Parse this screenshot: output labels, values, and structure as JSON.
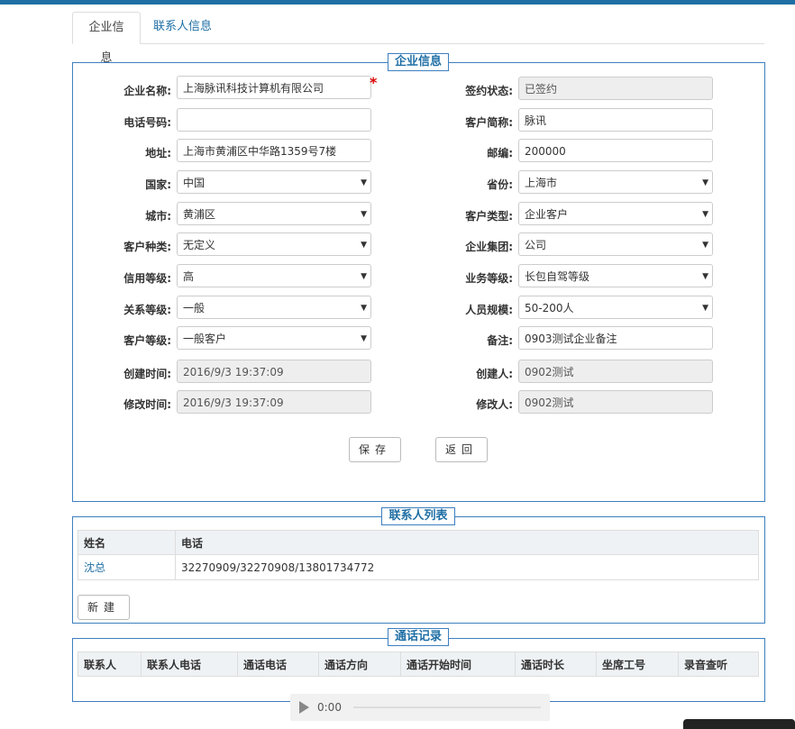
{
  "tabs": {
    "company": "企业信息",
    "contacts": "联系人信息"
  },
  "company_section": {
    "legend": "企业信息",
    "left": [
      {
        "label": "企业名称:",
        "value": "上海脉讯科技计算机有限公司",
        "type": "text",
        "readonly": false,
        "required": true
      },
      {
        "label": "电话号码:",
        "value": "",
        "type": "text",
        "readonly": false
      },
      {
        "label": "地址:",
        "value": "上海市黄浦区中华路1359号7楼",
        "type": "text",
        "readonly": false
      },
      {
        "label": "国家:",
        "value": "中国",
        "type": "select"
      },
      {
        "label": "城市:",
        "value": "黄浦区",
        "type": "select"
      },
      {
        "label": "客户种类:",
        "value": "无定义",
        "type": "select"
      },
      {
        "label": "信用等级:",
        "value": "高",
        "type": "select"
      },
      {
        "label": "关系等级:",
        "value": "一般",
        "type": "select"
      },
      {
        "label": "客户等级:",
        "value": "一般客户",
        "type": "select"
      },
      {
        "label": "创建时间:",
        "value": "2016/9/3 19:37:09",
        "type": "text",
        "readonly": true
      },
      {
        "label": "修改时间:",
        "value": "2016/9/3 19:37:09",
        "type": "text",
        "readonly": true
      }
    ],
    "right": [
      {
        "label": "签约状态:",
        "value": "已签约",
        "type": "text",
        "readonly": true
      },
      {
        "label": "客户简称:",
        "value": "脉讯",
        "type": "text",
        "readonly": false
      },
      {
        "label": "邮编:",
        "value": "200000",
        "type": "text",
        "readonly": false
      },
      {
        "label": "省份:",
        "value": "上海市",
        "type": "select"
      },
      {
        "label": "客户类型:",
        "value": "企业客户",
        "type": "select"
      },
      {
        "label": "企业集团:",
        "value": "公司",
        "type": "select"
      },
      {
        "label": "业务等级:",
        "value": "长包自驾等级",
        "type": "select"
      },
      {
        "label": "人员规模:",
        "value": "50-200人",
        "type": "select"
      },
      {
        "label": "备注:",
        "value": "0903测试企业备注",
        "type": "text",
        "readonly": false
      },
      {
        "label": "创建人:",
        "value": "0902测试",
        "type": "text",
        "readonly": true
      },
      {
        "label": "修改人:",
        "value": "0902测试",
        "type": "text",
        "readonly": true
      }
    ],
    "save_label": "保存",
    "back_label": "返回",
    "required_mark": "*"
  },
  "contacts_section": {
    "legend": "联系人列表",
    "columns": [
      "姓名",
      "电话"
    ],
    "rows": [
      {
        "name": "沈总",
        "phone": "32270909/32270908/13801734772"
      }
    ],
    "new_label": "新建"
  },
  "calls_section": {
    "legend": "通话记录",
    "columns": [
      "联系人",
      "联系人电话",
      "通话电话",
      "通话方向",
      "通话开始时间",
      "通话时长",
      "坐席工号",
      "录音查听"
    ]
  },
  "audio_player": {
    "time": "0:00"
  },
  "colors": {
    "accent": "#1f6fa5",
    "border": "#3d7fbf",
    "required": "#dd0000"
  }
}
